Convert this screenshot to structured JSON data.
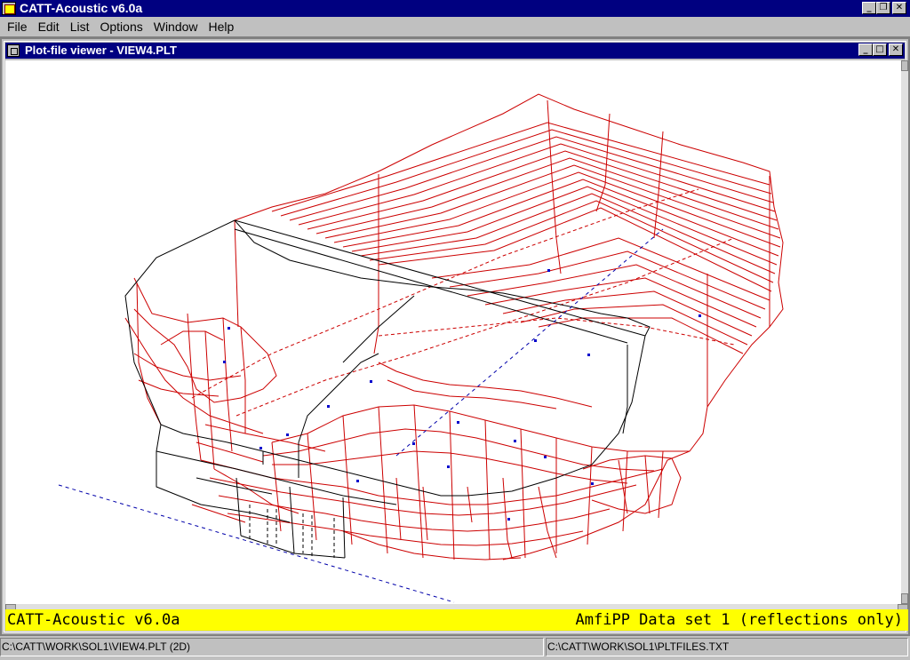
{
  "app": {
    "title": "CATT-Acoustic v6.0a",
    "window_buttons": {
      "minimize": "_",
      "restore": "❐",
      "close": "✕"
    }
  },
  "menu": [
    "File",
    "Edit",
    "List",
    "Options",
    "Window",
    "Help"
  ],
  "child_window": {
    "title": "Plot-file viewer - VIEW4.PLT",
    "window_buttons": {
      "minimize": "_",
      "maximize": "□",
      "close": "✕"
    }
  },
  "info_bar": {
    "left": "CATT-Acoustic v6.0a",
    "right": "AmfiPP Data set 1 (reflections only)",
    "background": "#ffff00"
  },
  "status_bar": {
    "left": "C:\\CATT\\WORK\\SOL1\\VIEW4.PLT (2D)",
    "right": "C:\\CATT\\WORK\\SOL1\\PLTFILES.TXT"
  },
  "colors": {
    "title_bar": "#000080",
    "wireframe_red": "#cc0000",
    "wireframe_black": "#000000",
    "dashed_blue": "#0000aa"
  },
  "icons": [
    "app-icon",
    "document-icon",
    "minimize-icon",
    "restore-icon",
    "maximize-icon",
    "close-icon"
  ]
}
